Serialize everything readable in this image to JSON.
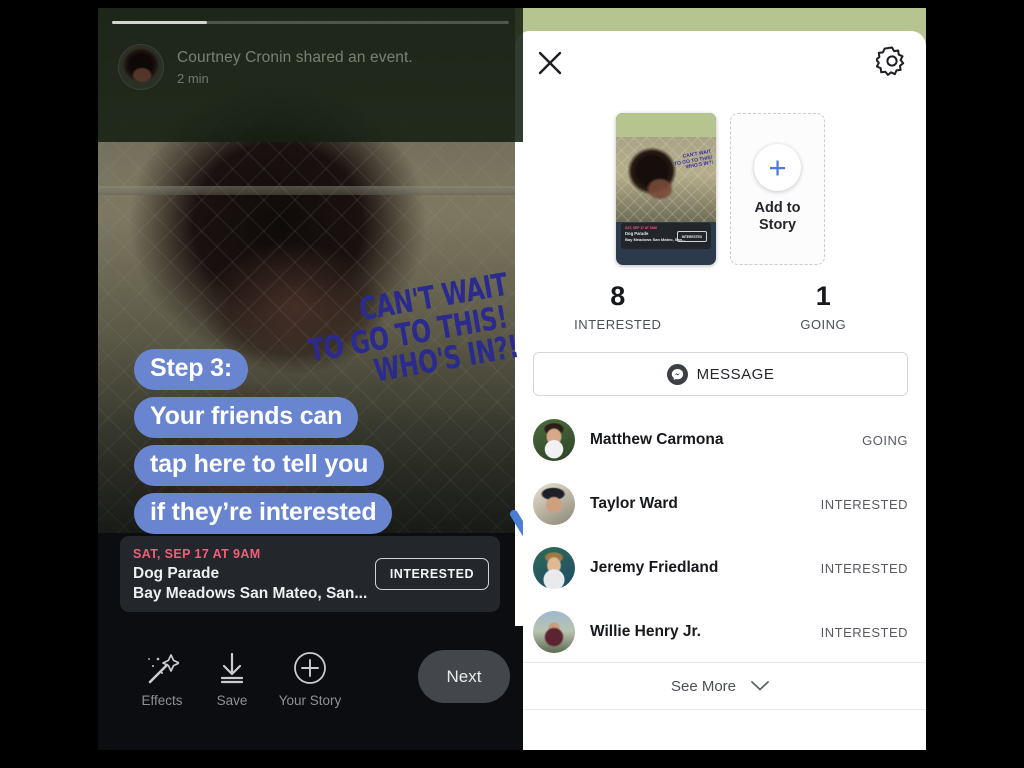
{
  "left_panel": {
    "progress_percent": 24,
    "poster": {
      "avatar": "profile-avatar",
      "name": "Courtney Cronin shared an event.",
      "time": "2 min"
    },
    "sticker": {
      "line1": "CAN'T WAIT",
      "line2": "TO GO TO THIS!",
      "line3": "WHO'S IN?!",
      "color": "#2b2a8e"
    },
    "captions": [
      "Step 3:",
      "Your friends can",
      "tap here to tell you",
      "if they’re interested"
    ],
    "caption_bg": "#6985d0",
    "arrow_color": "#4a7fd4",
    "event_card": {
      "date": "SAT, SEP 17 AT 9AM",
      "date_color": "#f25e7a",
      "title": "Dog Parade",
      "location": "Bay Meadows San Mateo, San...",
      "button_label": "INTERESTED"
    },
    "toolbar": {
      "effects_label": "Effects",
      "effects_icon": "magic-wand-icon",
      "save_label": "Save",
      "save_icon": "download-icon",
      "your_story_label": "Your Story",
      "your_story_icon": "plus-circle-icon",
      "next_label": "Next"
    }
  },
  "right_panel": {
    "header_color": "#b6c48f",
    "close_icon": "close-icon",
    "settings_icon": "gear-icon",
    "story_thumbnail": {
      "sticker_line1": "CAN'T WAIT",
      "sticker_line2": "TO GO TO THIS!",
      "sticker_line3": "WHO'S IN?!",
      "card_date": "SAT, SEP 17 AT 9AM",
      "card_title": "Dog Parade",
      "card_location": "Bay Meadows San Mateo, San...",
      "card_button": "INTERESTED"
    },
    "add_to_story": {
      "label_line1": "Add to",
      "label_line2": "Story",
      "plus_icon": "plus-icon",
      "plus_color": "#4a7cd8"
    },
    "counts": [
      {
        "number": "8",
        "label": "INTERESTED"
      },
      {
        "number": "1",
        "label": "GOING"
      }
    ],
    "message_button": {
      "label": "MESSAGE",
      "icon": "messenger-icon"
    },
    "friends": [
      {
        "name": "Matthew Carmona",
        "status": "GOING",
        "avatar": "avatar-matthew-carmona"
      },
      {
        "name": "Taylor Ward",
        "status": "INTERESTED",
        "avatar": "avatar-taylor-ward"
      },
      {
        "name": "Jeremy Friedland",
        "status": "INTERESTED",
        "avatar": "avatar-jeremy-friedland"
      },
      {
        "name": "Willie Henry Jr.",
        "status": "INTERESTED",
        "avatar": "avatar-willie-henry-jr"
      }
    ],
    "see_more": {
      "label": "See More",
      "icon": "chevron-down-icon"
    }
  }
}
